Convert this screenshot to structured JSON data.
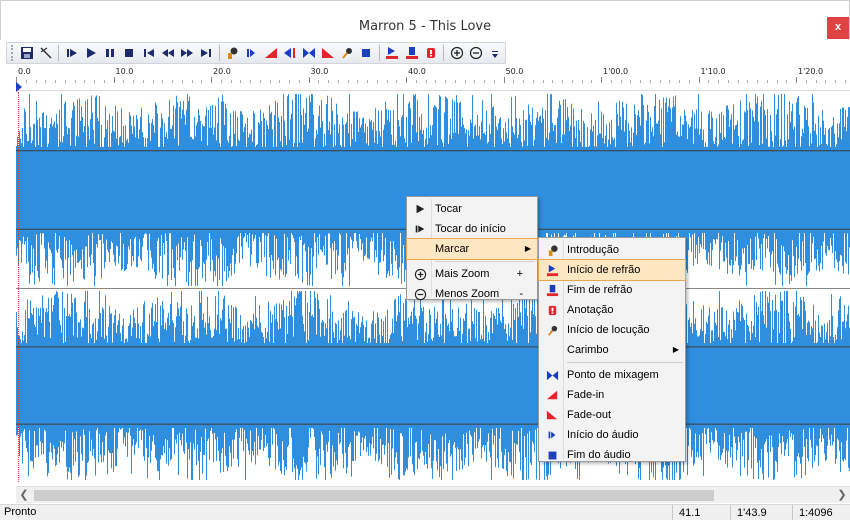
{
  "window": {
    "title": "Marron 5 - This Love",
    "close_label": "x"
  },
  "toolbar": {
    "buttons": [
      "save-icon",
      "cut-icon",
      "play-from-cursor-icon",
      "play-icon",
      "pause-icon",
      "stop-icon",
      "go-to-start-icon",
      "rewind-icon",
      "fast-forward-icon",
      "go-to-end-icon",
      "intro-marker-icon",
      "audio-start-icon",
      "fade-in-icon",
      "mix-in-icon",
      "mix-point-icon",
      "fade-out-icon",
      "voice-start-icon",
      "audio-end-icon",
      "chorus-start-icon",
      "chorus-end-icon",
      "annotation-icon",
      "zoom-in-icon",
      "zoom-out-icon",
      "toolbar-overflow-icon"
    ]
  },
  "ruler": {
    "labels": [
      "0.0",
      "10.0",
      "20.0",
      "30.0",
      "40.0",
      "50.0",
      "1'00.0",
      "1'10.0",
      "1'20.0"
    ]
  },
  "context_menu": {
    "items": [
      {
        "label": "Tocar",
        "icon": "play-icon"
      },
      {
        "label": "Tocar do início",
        "icon": "play-from-start-icon"
      },
      {
        "label": "Marcar",
        "icon": "",
        "submenu": true
      },
      {
        "label": "Mais Zoom",
        "icon": "zoom-in-icon",
        "shortcut": "+"
      },
      {
        "label": "Menos Zoom",
        "icon": "zoom-out-icon",
        "shortcut": "-"
      }
    ]
  },
  "submenu": {
    "items": [
      {
        "label": "Introdução",
        "icon": "intro-marker-icon"
      },
      {
        "label": "Início de refrão",
        "icon": "chorus-start-icon"
      },
      {
        "label": "Fim de refrão",
        "icon": "chorus-end-icon"
      },
      {
        "label": "Anotação",
        "icon": "annotation-icon"
      },
      {
        "label": "Início de locução",
        "icon": "voice-start-icon"
      },
      {
        "label": "Carimbo",
        "icon": "",
        "submenu": true
      },
      {
        "label": "Ponto de mixagem",
        "icon": "mix-point-icon"
      },
      {
        "label": "Fade-in",
        "icon": "fade-in-icon"
      },
      {
        "label": "Fade-out",
        "icon": "fade-out-icon"
      },
      {
        "label": "Início do áudio",
        "icon": "audio-start-icon"
      },
      {
        "label": "Fim do áudio",
        "icon": "audio-end-icon"
      }
    ]
  },
  "statusbar": {
    "text": "Pronto",
    "position": "41.1",
    "duration": "1'43.9",
    "zoom": "1:4096"
  },
  "colors": {
    "waveform": "#2f8fde",
    "accent_red": "#e0262b",
    "accent_blue": "#1b3fbf"
  }
}
